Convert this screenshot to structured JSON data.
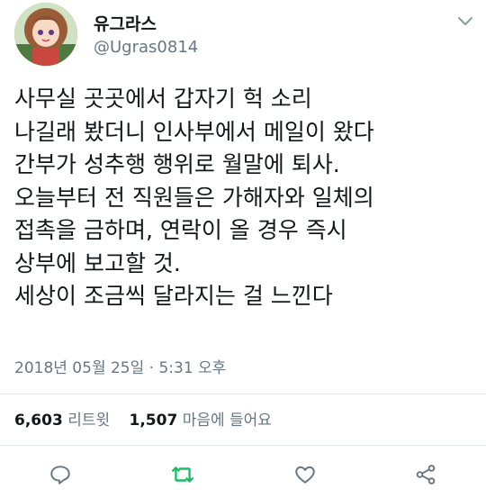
{
  "user": {
    "display_name": "유그라스",
    "handle": "@Ugras0814"
  },
  "tweet": {
    "lines": [
      "사무실 곳곳에서 갑자기 헉 소리",
      "나길래 봤더니 인사부에서 메일이 왔다",
      "간부가 성추행 행위로 월말에 퇴사.",
      "오늘부터 전 직원들은 가해자와 일체의",
      "접촉을 금하며, 연락이 올 경우 즉시",
      "상부에 보고할 것.",
      "세상이 조금씩 달라지는 걸 느낀다"
    ],
    "timestamp": "2018년 05월 25일 · 5:31 오후"
  },
  "stats": {
    "retweets_count": "6,603",
    "retweets_label": "리트윗",
    "likes_count": "1,507",
    "likes_label": "마음에 들어요"
  },
  "actions": {
    "icons": [
      "reply-icon",
      "retweet-icon",
      "like-icon",
      "share-icon"
    ],
    "retweet_color": "#17bf63",
    "default_color": "#657786"
  },
  "colors": {
    "text": "#14171a",
    "secondary": "#657786",
    "divider": "#e1e8ed"
  }
}
